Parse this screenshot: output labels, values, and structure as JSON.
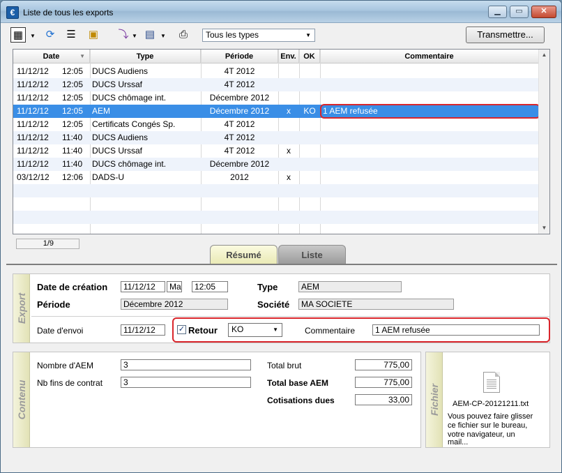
{
  "window": {
    "title": "Liste de tous les exports",
    "app_icon": "€"
  },
  "toolbar": {
    "icons": [
      "export-menu-icon",
      "refresh-icon",
      "list-icon",
      "calendar-user-icon",
      "send-menu-icon",
      "monitor-menu-icon",
      "print-icon"
    ],
    "type_filter": "Tous les types",
    "transmit_label": "Transmettre..."
  },
  "grid": {
    "headers": {
      "date": "Date",
      "type": "Type",
      "periode": "Période",
      "env": "Env.",
      "ok": "OK",
      "commentaire": "Commentaire"
    },
    "rows": [
      {
        "date": "11/12/12",
        "time": "12:05",
        "type": "DUCS Audiens",
        "periode": "4T 2012",
        "env": "",
        "ok": "",
        "commentaire": ""
      },
      {
        "date": "11/12/12",
        "time": "12:05",
        "type": "DUCS Urssaf",
        "periode": "4T 2012",
        "env": "",
        "ok": "",
        "commentaire": ""
      },
      {
        "date": "11/12/12",
        "time": "12:05",
        "type": "DUCS chômage int.",
        "periode": "Décembre 2012",
        "env": "",
        "ok": "",
        "commentaire": ""
      },
      {
        "date": "11/12/12",
        "time": "12:05",
        "type": "AEM",
        "periode": "Décembre 2012",
        "env": "x",
        "ok": "KO",
        "commentaire": "1 AEM refusée"
      },
      {
        "date": "11/12/12",
        "time": "12:05",
        "type": "Certificats Congés Sp.",
        "periode": "4T 2012",
        "env": "",
        "ok": "",
        "commentaire": ""
      },
      {
        "date": "11/12/12",
        "time": "11:40",
        "type": "DUCS Audiens",
        "periode": "4T 2012",
        "env": "",
        "ok": "",
        "commentaire": ""
      },
      {
        "date": "11/12/12",
        "time": "11:40",
        "type": "DUCS Urssaf",
        "periode": "4T 2012",
        "env": "x",
        "ok": "",
        "commentaire": ""
      },
      {
        "date": "11/12/12",
        "time": "11:40",
        "type": "DUCS chômage int.",
        "periode": "Décembre 2012",
        "env": "",
        "ok": "",
        "commentaire": ""
      },
      {
        "date": "03/12/12",
        "time": "12:06",
        "type": "DADS-U",
        "periode": "2012",
        "env": "x",
        "ok": "",
        "commentaire": ""
      }
    ],
    "counter": "1/9"
  },
  "tabs": {
    "resume": "Résumé",
    "liste": "Liste"
  },
  "export": {
    "side_label": "Export",
    "date_creation_label": "Date de création",
    "date_creation": "11/12/12",
    "day": "Ma",
    "time": "12:05",
    "type_label": "Type",
    "type_value": "AEM",
    "periode_label": "Période",
    "periode_value": "Décembre 2012",
    "societe_label": "Société",
    "societe_value": "MA SOCIETE",
    "date_envoi_label": "Date d'envoi",
    "date_envoi": "11/12/12",
    "retour_label": "Retour",
    "retour_checked": "✓",
    "retour_value": "KO",
    "commentaire_label": "Commentaire",
    "commentaire_value": "1 AEM refusée"
  },
  "contenu": {
    "side_label": "Contenu",
    "nombre_aem_label": "Nombre d'AEM",
    "nombre_aem": "3",
    "nb_fins_label": "Nb fins de contrat",
    "nb_fins": "3",
    "total_brut_label": "Total brut",
    "total_brut": "775,00",
    "total_base_label": "Total base AEM",
    "total_base": "775,00",
    "cotisations_label": "Cotisations dues",
    "cotisations": "33,00"
  },
  "fichier": {
    "side_label": "Fichier",
    "filename": "AEM-CP-20121211.txt",
    "hint_1": "Vous pouvez faire glisser",
    "hint_2": "ce fichier sur le bureau,",
    "hint_3": "votre navigateur, un",
    "hint_4": "mail..."
  },
  "colors": {
    "selection": "#3a8ee6",
    "highlight": "#d9262c"
  }
}
